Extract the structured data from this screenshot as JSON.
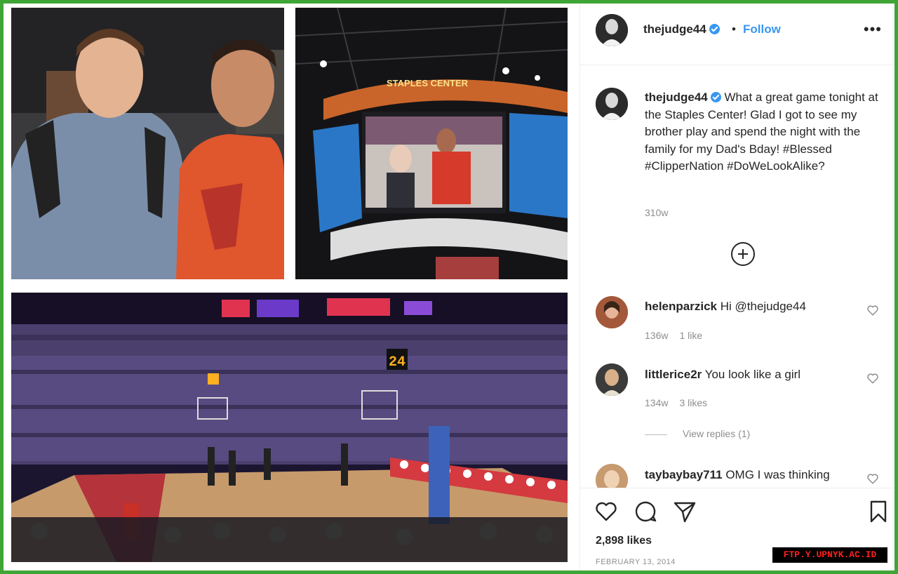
{
  "post": {
    "username": "thejudge44",
    "dot": "•",
    "follow_label": "Follow",
    "more_label": "•••",
    "caption_text": "What a great game tonight at the Staples Center! Glad I got to see my brother play and spend the night with the family for my Dad's Bday! #Blessed #ClipperNation #DoWeLookAlike?",
    "caption_time": "310w",
    "likes": "2,898 likes",
    "date": "FEBRUARY 13, 2014"
  },
  "photos": {
    "arena_sign": "STAPLES CENTER",
    "shot_clock": "24"
  },
  "comments": [
    {
      "username": "helenparzick",
      "text": "Hi @thejudge44",
      "time": "136w",
      "likes": "1 like"
    },
    {
      "username": "littlerice2r",
      "text": "You look like a girl",
      "time": "134w",
      "likes": "3 likes"
    },
    {
      "username": "taybaybay711",
      "text": "OMG I was thinking"
    }
  ],
  "view_replies": "View replies (1)",
  "icons": [
    "heart-icon",
    "comment-icon",
    "share-icon",
    "bookmark-icon",
    "plus-circle-icon",
    "verified-icon",
    "more-icon"
  ],
  "watermark": "FTP.Y.UPNYK.AC.ID",
  "colors": {
    "border": "#3fa535",
    "link": "#3897f0",
    "muted": "#8e8e8e"
  }
}
